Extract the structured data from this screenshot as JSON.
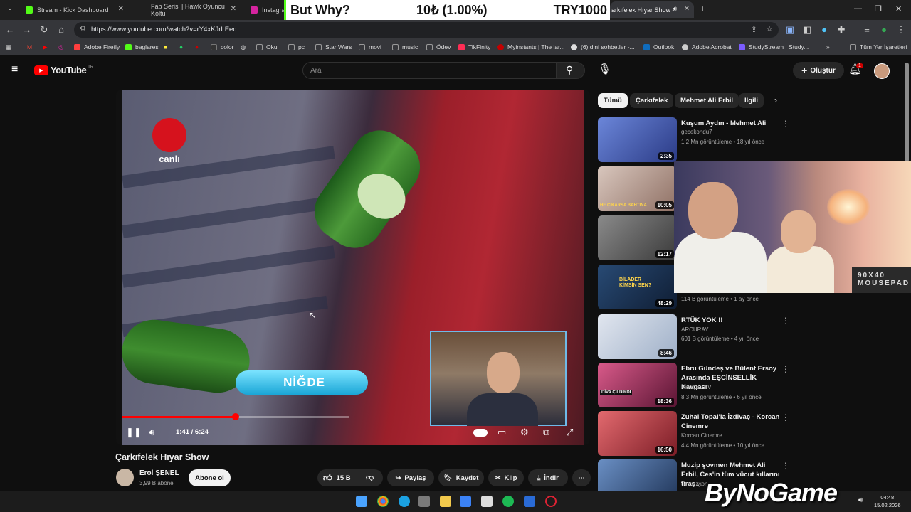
{
  "browser": {
    "tabs": [
      {
        "label": "Stream - Kick Dashboard",
        "favicon_color": "#53fc18"
      },
      {
        "label": "Fab Serisi | Hawk Oyuncu Koltu",
        "favicon_color": "#e0e0e0"
      },
      {
        "label": "Instagram",
        "favicon_color": "#d6249f"
      },
      {
        "label": "arkıfelek Hıyar Show -",
        "favicon_color": "#ff0000"
      }
    ],
    "new_tab_label": "+",
    "url": "https://www.youtube.com/watch?v=rY4xKJrLEec",
    "bookmarks": [
      {
        "label": "Adobe Firefly",
        "color": "#ff3e3e"
      },
      {
        "label": "baglares",
        "color": "#53fc18"
      },
      {
        "label": "color",
        "color": "#333333"
      },
      {
        "label": "Okul",
        "color": "#999999"
      },
      {
        "label": "pc",
        "color": "#999999"
      },
      {
        "label": "Star Wars",
        "color": "#999999"
      },
      {
        "label": "movi",
        "color": "#999999"
      },
      {
        "label": "music",
        "color": "#999999"
      },
      {
        "label": "Ödev",
        "color": "#999999"
      },
      {
        "label": "TikFinity",
        "color": "#ff2d55"
      },
      {
        "label": "Myinstants | The lar...",
        "color": "#c40000"
      },
      {
        "label": "(6) dini sohbetler -...",
        "color": "#dddddd"
      },
      {
        "label": "Outlook",
        "color": "#0f6cbd"
      },
      {
        "label": "Adobe Acrobat",
        "color": "#cccccc"
      },
      {
        "label": "StudyStream | Study...",
        "color": "#7b5cff"
      },
      {
        "label": "Tüm Yer İşaretleri",
        "color": "#999999"
      }
    ]
  },
  "stream_overlay": {
    "question": "But Why?",
    "amount_try": "10₺ (1.00%)",
    "goal": "TRY1000"
  },
  "youtube": {
    "logo_text": "YouTube",
    "region": "TR",
    "search_placeholder": "Ara",
    "create_label": "Oluştur",
    "notification_count": "1",
    "player": {
      "channel_logo_text": "canlı",
      "lower_third": "NİĞDE",
      "time": "1:41 / 6:24",
      "progress": 0.5
    },
    "video": {
      "title": "Çarkıfelek Hıyar Show",
      "channel": "Erol ŞENEL",
      "subscribers": "3,99 B abone",
      "subscribe_label": "Abone ol",
      "likes": "15 B",
      "share_label": "Paylaş",
      "save_label": "Kaydet",
      "clip_label": "Klip",
      "download_label": "İndir"
    },
    "chips": [
      "Tümü",
      "Çarkıfelek",
      "Mehmet Ali Erbil",
      "İlgili"
    ],
    "recommended": [
      {
        "title": "Kuşum Aydın - Mehmet Ali",
        "channel": "gecekondu7",
        "meta": "1,2 Mn görüntüleme • 18 yıl önce",
        "duration": "2:35",
        "thumb": "#5b72c9"
      },
      {
        "title": "",
        "channel": "",
        "meta": "",
        "duration": "10:05",
        "thumb": "#b9a7a0",
        "thumb_caption": "HE ÇIKARSA BAHTINA"
      },
      {
        "title": "",
        "channel": "",
        "meta": "",
        "duration": "12:17",
        "thumb": "#6a6a6a"
      },
      {
        "title": "",
        "channel": "",
        "meta": "114 B görüntüleme • 1 ay önce",
        "duration": "48:29",
        "thumb": "#1d3556",
        "thumb_caption": "BİLADER KİMSİN SEN?"
      },
      {
        "title": "RTÜK YOK !!",
        "channel": "ARCURAY",
        "meta": "601 B görüntüleme • 4 yıl önce",
        "duration": "8:46",
        "thumb": "#cfd7e5"
      },
      {
        "title": "Ebru Gündeş ve Bülent Ersoy Arasında EŞCİNSELLİK Kavgası",
        "channel": "VideoBu TV",
        "meta": "8,3 Mn görüntüleme • 6 yıl önce",
        "duration": "18:36",
        "thumb": "#b1365f",
        "thumb_caption": "DİVA ÇILDIRDI"
      },
      {
        "title": "Zuhal Topal'la İzdivaç - Korcan Cinemre",
        "channel": "Korcan Cinemre",
        "meta": "4,4 Mn görüntüleme • 10 yıl önce",
        "duration": "16:50",
        "thumb": "#c9424a"
      },
      {
        "title": "Muzip şovmen Mehmet Ali Erbil, Ces'in tüm vücut kıllarını tıraş ...",
        "channel": "Televizyon",
        "meta": "",
        "duration": "",
        "thumb": "#466b9c"
      }
    ]
  },
  "webcam": {
    "poster_text": "90X40 MOUSEPAD"
  },
  "taskbar": {
    "time": "04:48",
    "date": "15.02.2026"
  },
  "watermark": "ByNoGame"
}
